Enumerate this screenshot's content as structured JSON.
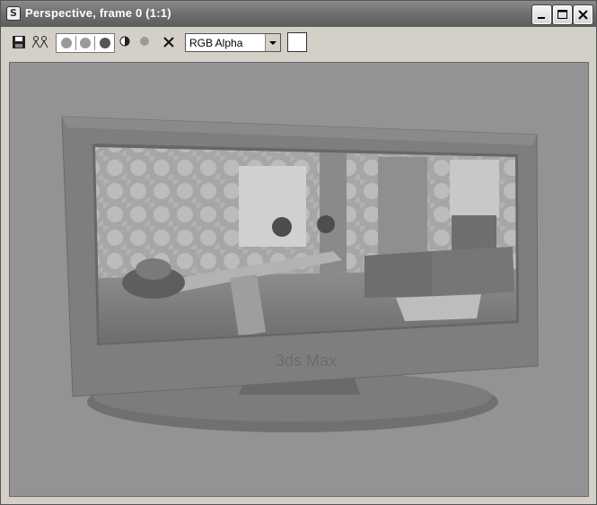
{
  "window": {
    "title": "Perspective, frame 0 (1:1)",
    "accent": "#6e6e6e"
  },
  "window_controls": {
    "minimize": "minimize-icon",
    "maximize": "maximize-icon",
    "close": "close-icon"
  },
  "toolbar": {
    "save_icon": "save-icon",
    "clone_icon": "clone-icon",
    "channels": [
      "red-channel",
      "green-channel",
      "blue-channel"
    ],
    "alpha_icon": "alpha-toggle-icon",
    "mono_icon": "monochrome-icon",
    "clear_icon": "clear-icon",
    "channel_select": "RGB Alpha",
    "swatch_color": "#ffffff"
  },
  "viewport": {
    "logo": "3ds Max"
  }
}
